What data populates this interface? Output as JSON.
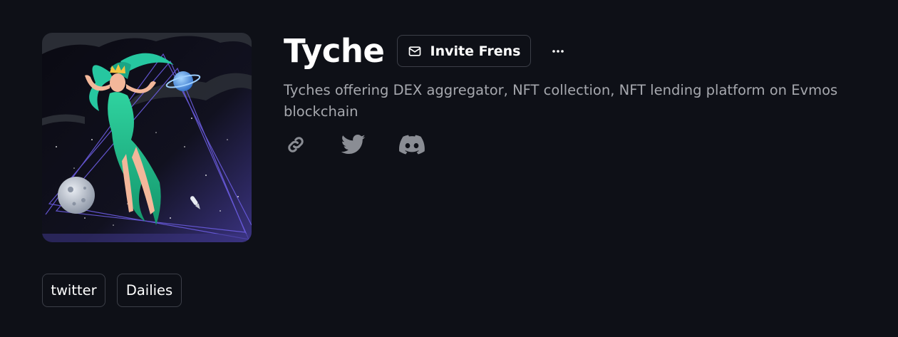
{
  "project": {
    "name": "Tyche",
    "description": "Tyches offering DEX aggregator, NFT collection, NFT lending platform on Evmos blockchain",
    "avatar_alt": "Tyche"
  },
  "actions": {
    "invite_label": "Invite Frens",
    "invite_icon": "mail-icon",
    "more_icon": "more-horizontal-icon"
  },
  "socials": [
    {
      "icon": "link-icon"
    },
    {
      "icon": "twitter-icon"
    },
    {
      "icon": "discord-icon"
    }
  ],
  "tags": [
    "twitter",
    "Dailies"
  ],
  "colors": {
    "background": "#0e1017",
    "muted_text": "#a6a8ae",
    "border": "#3c3f48",
    "icon": "#8a8d94"
  }
}
